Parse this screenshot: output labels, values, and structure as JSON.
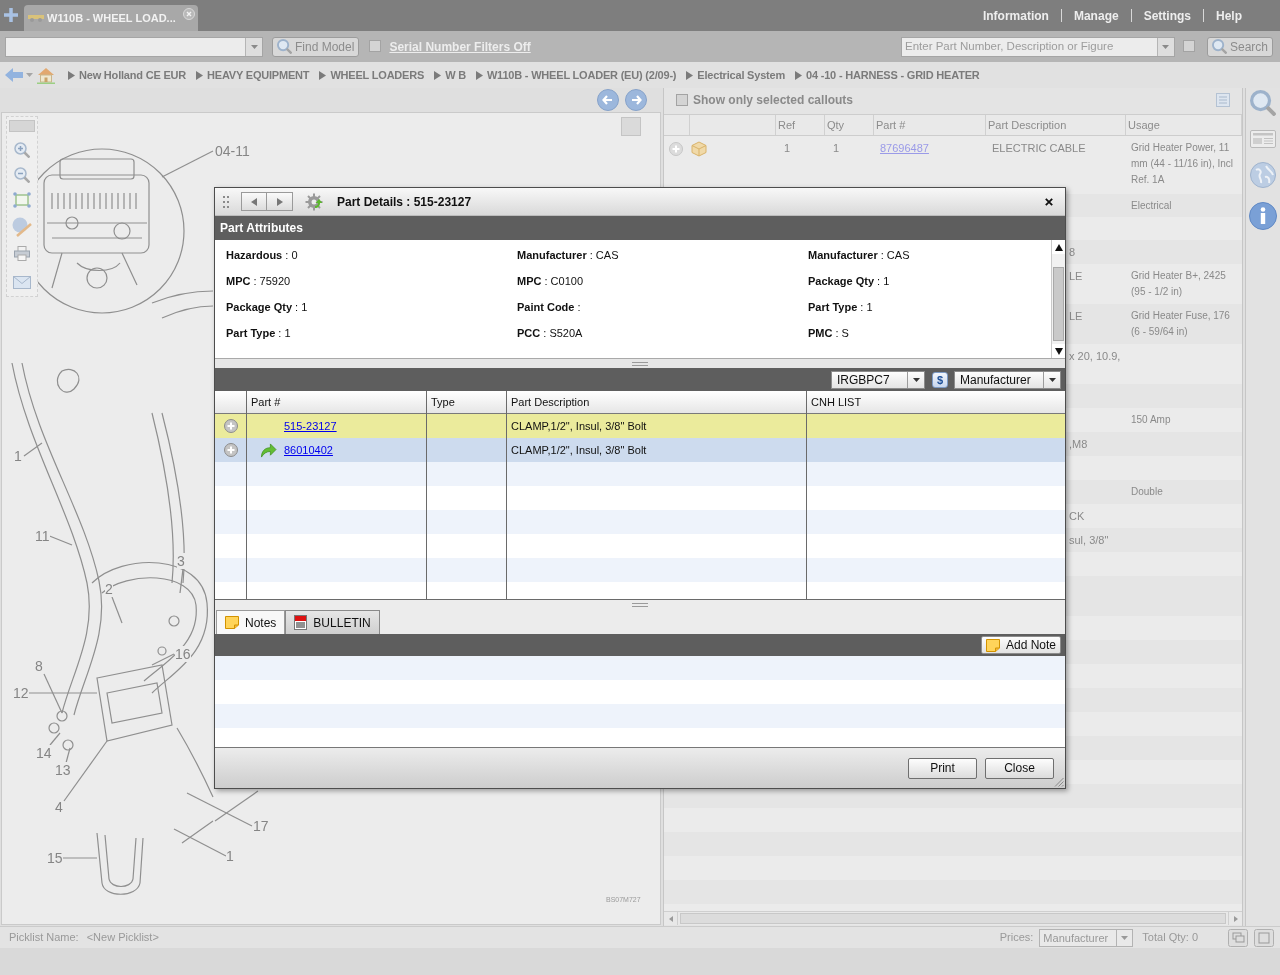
{
  "app_bar": {
    "tabs": [
      {
        "label": "W110B - WHEEL LOAD...",
        "selected": true
      }
    ],
    "menu": [
      "Information",
      "Manage",
      "Settings",
      "Help"
    ]
  },
  "toolbar": {
    "find_model": "Find Model",
    "serial_filter": {
      "label": "Serial Number Filters Off",
      "checked": false
    },
    "search_field": {
      "placeholder": "Enter Part Number, Description or Figure"
    },
    "search_option": {
      "checked": false
    },
    "search_button": "Search"
  },
  "breadcrumb": [
    "New Holland CE EUR",
    "HEAVY EQUIPMENT",
    "WHEEL LOADERS",
    "W B",
    "W110B - WHEEL LOADER (EU) (2/09-)",
    "Electrical System",
    "04 -10 - HARNESS - GRID HEATER"
  ],
  "diagram": {
    "callouts": [
      "04-11",
      "1",
      "11",
      "3",
      "2",
      "16",
      "8",
      "12",
      "14",
      "13",
      "4",
      "17",
      "15",
      "1"
    ],
    "drawing_number": "BS07M727"
  },
  "parts_list": {
    "show_selected_only": {
      "label": "Show only selected callouts",
      "checked": false
    },
    "columns": [
      "Ref",
      "Qty",
      "Part #",
      "Part Description",
      "Usage"
    ],
    "rows": [
      {
        "kind": "full",
        "ref": "1",
        "qty": "1",
        "part": "87696487",
        "description": "ELECTRIC CABLE",
        "usage": [
          "Grid Heater Power, 11",
          "mm (44 - 11/16 in), Incl",
          "Ref. 1A"
        ]
      },
      {
        "kind": "covered",
        "usage": [
          "Electrical"
        ]
      },
      {
        "kind": "covered"
      },
      {
        "kind": "covered",
        "description": "8"
      },
      {
        "kind": "covered",
        "description": "LE",
        "usage": [
          "Grid Heater B+, 2425",
          "(95 - 1/2 in)"
        ]
      },
      {
        "kind": "covered",
        "description": "LE",
        "usage": [
          "Grid Heater Fuse, 176",
          "(6 - 59/64 in)"
        ]
      },
      {
        "kind": "covered",
        "description": "x 20, 10.9,"
      },
      {
        "kind": "covered"
      },
      {
        "kind": "covered",
        "usage": [
          "150 Amp"
        ]
      },
      {
        "kind": "covered",
        "description": ",M8"
      },
      {
        "kind": "covered"
      },
      {
        "kind": "covered",
        "usage": [
          "Double"
        ]
      },
      {
        "kind": "covered",
        "description": "CK"
      },
      {
        "kind": "covered",
        "description": "sul, 3/8\""
      },
      {
        "kind": "covered"
      },
      {
        "kind": "covered"
      }
    ]
  },
  "status_bar": {
    "picklist_label": "Picklist Name:",
    "picklist_name": "<New Picklist>",
    "prices_label": "Prices:",
    "prices": "Manufacturer",
    "total_qty": "Total Qty: 0"
  },
  "dialog": {
    "title": "Part Details : 515-23127",
    "attributes_title": "Part Attributes",
    "attributes": [
      "**Hazardous** : 0",
      "**Manufacturer** : CAS",
      "**Manufacturer** : CAS",
      "**MPC** : 75920",
      "**MPC** : C0100",
      "**Package Qty** : 1",
      "**Package Qty** : 1",
      "**Paint Code** :",
      "**Part Type** : 1",
      "**Part Type** : 1",
      "**PCC** : S520A",
      "**PMC** : S"
    ],
    "price_list": "IRGBPC7",
    "currency": "$",
    "price_type": "Manufacturer",
    "columns": [
      "Part #",
      "Type",
      "Part Description",
      "CNH LIST"
    ],
    "parts": [
      {
        "kind": "part",
        "part": "515-23127",
        "description": "CLAMP,1/2\", Insul, 3/8\" Bolt",
        "selected": true,
        "highlighted": false
      },
      {
        "kind": "replacement",
        "part": "86010402",
        "description": "CLAMP,1/2\", Insul, 3/8\" Bolt",
        "selected": false,
        "highlighted": true
      }
    ],
    "tabs": [
      {
        "kind": "notes",
        "label": "Notes",
        "selected": true
      },
      {
        "kind": "bulletin",
        "label": "BULLETIN",
        "selected": false
      }
    ],
    "add_note": "Add Note",
    "buttons": [
      "Print",
      "Close"
    ]
  }
}
